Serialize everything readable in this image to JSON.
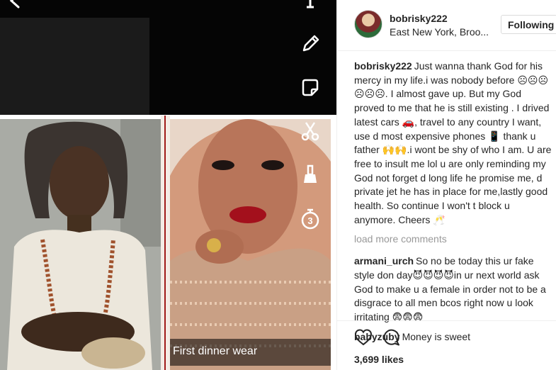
{
  "post": {
    "username": "bobrisky222",
    "location": "East New York, Broo...",
    "follow_label": "Following"
  },
  "media": {
    "caption": "First dinner wear",
    "timer_value": "3"
  },
  "comments": [
    {
      "author": "bobrisky222",
      "text": "Just wanna thank God for his mercy in my life.i was nobody before ☹☹☹☹☹☹. I almost gave up. But my God proved to me that he is still existing . I drived latest cars 🚗, travel to any country I want, use d most expensive phones 📱 thank u father 🙌🙌.i wont be shy of who I am. U are free to insult me lol u are only reminding my God not forget d long life he promise me, d private jet he has in place for me,lastly good health. So continue I won't t block u anymore. Cheers 🥂"
    }
  ],
  "load_more_label": "load more comments",
  "replies": [
    {
      "author": "armani_urch",
      "text": "So no be today this ur fake style don day😈😈😈😈in ur next world ask God to make u a female in order not to be a disgrace to all men bcos right now u look irritating 😨😨😨"
    },
    {
      "author": "babyzuby",
      "text": "Money is sweet"
    }
  ],
  "likes_text": "3,699 likes",
  "colors": {
    "divider_red": "#a01a1a",
    "text": "#262626",
    "muted": "#999999"
  }
}
